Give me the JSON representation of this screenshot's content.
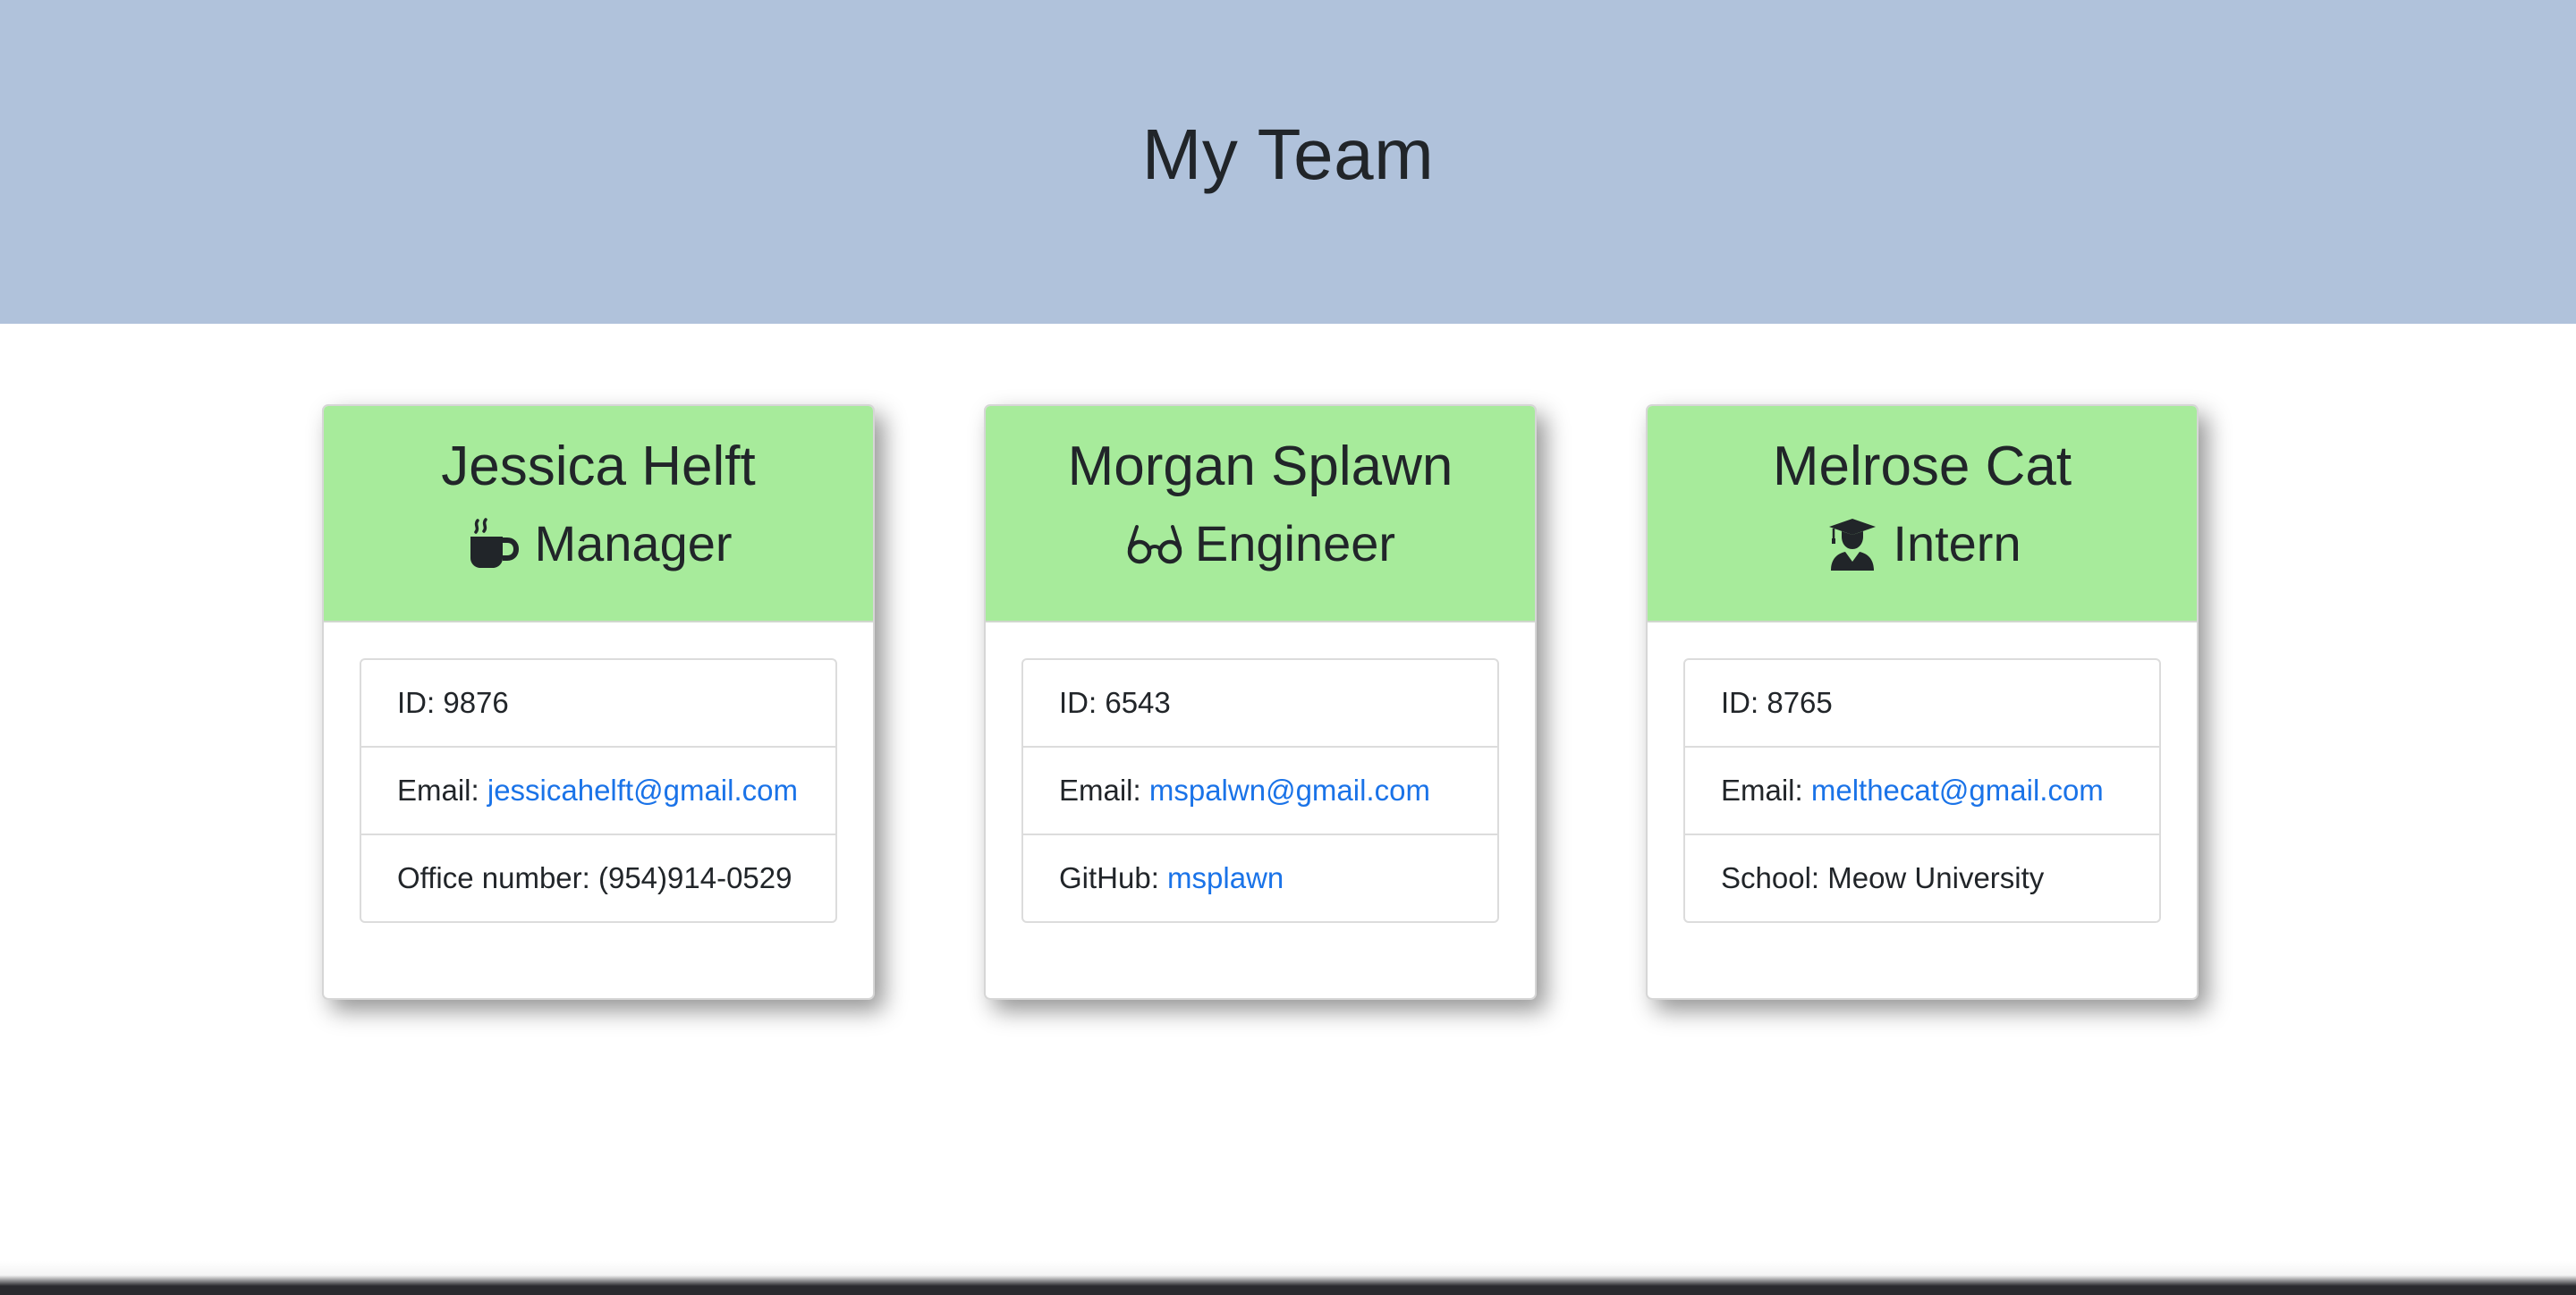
{
  "header": {
    "title": "My Team"
  },
  "team": [
    {
      "name": "Jessica Helft",
      "role": "Manager",
      "role_icon": "coffee-mug-icon",
      "id_label": "ID: 9876",
      "email_label": "Email: ",
      "email": "jessicahelft@gmail.com",
      "extra_label": "Office number: (954)914-0529",
      "extra_link": null
    },
    {
      "name": "Morgan Splawn",
      "role": "Engineer",
      "role_icon": "glasses-icon",
      "id_label": "ID: 6543",
      "email_label": "Email: ",
      "email": "mspalwn@gmail.com",
      "extra_label": "GitHub: ",
      "extra_link": "msplawn"
    },
    {
      "name": "Melrose Cat",
      "role": "Intern",
      "role_icon": "graduate-icon",
      "id_label": "ID: 8765",
      "email_label": "Email: ",
      "email": "melthecat@gmail.com",
      "extra_label": "School: Meow University",
      "extra_link": null
    }
  ],
  "colors": {
    "jumbotron_bg": "#b0c2db",
    "card_header_bg": "#a7eb9b",
    "link": "#1a73e8"
  }
}
